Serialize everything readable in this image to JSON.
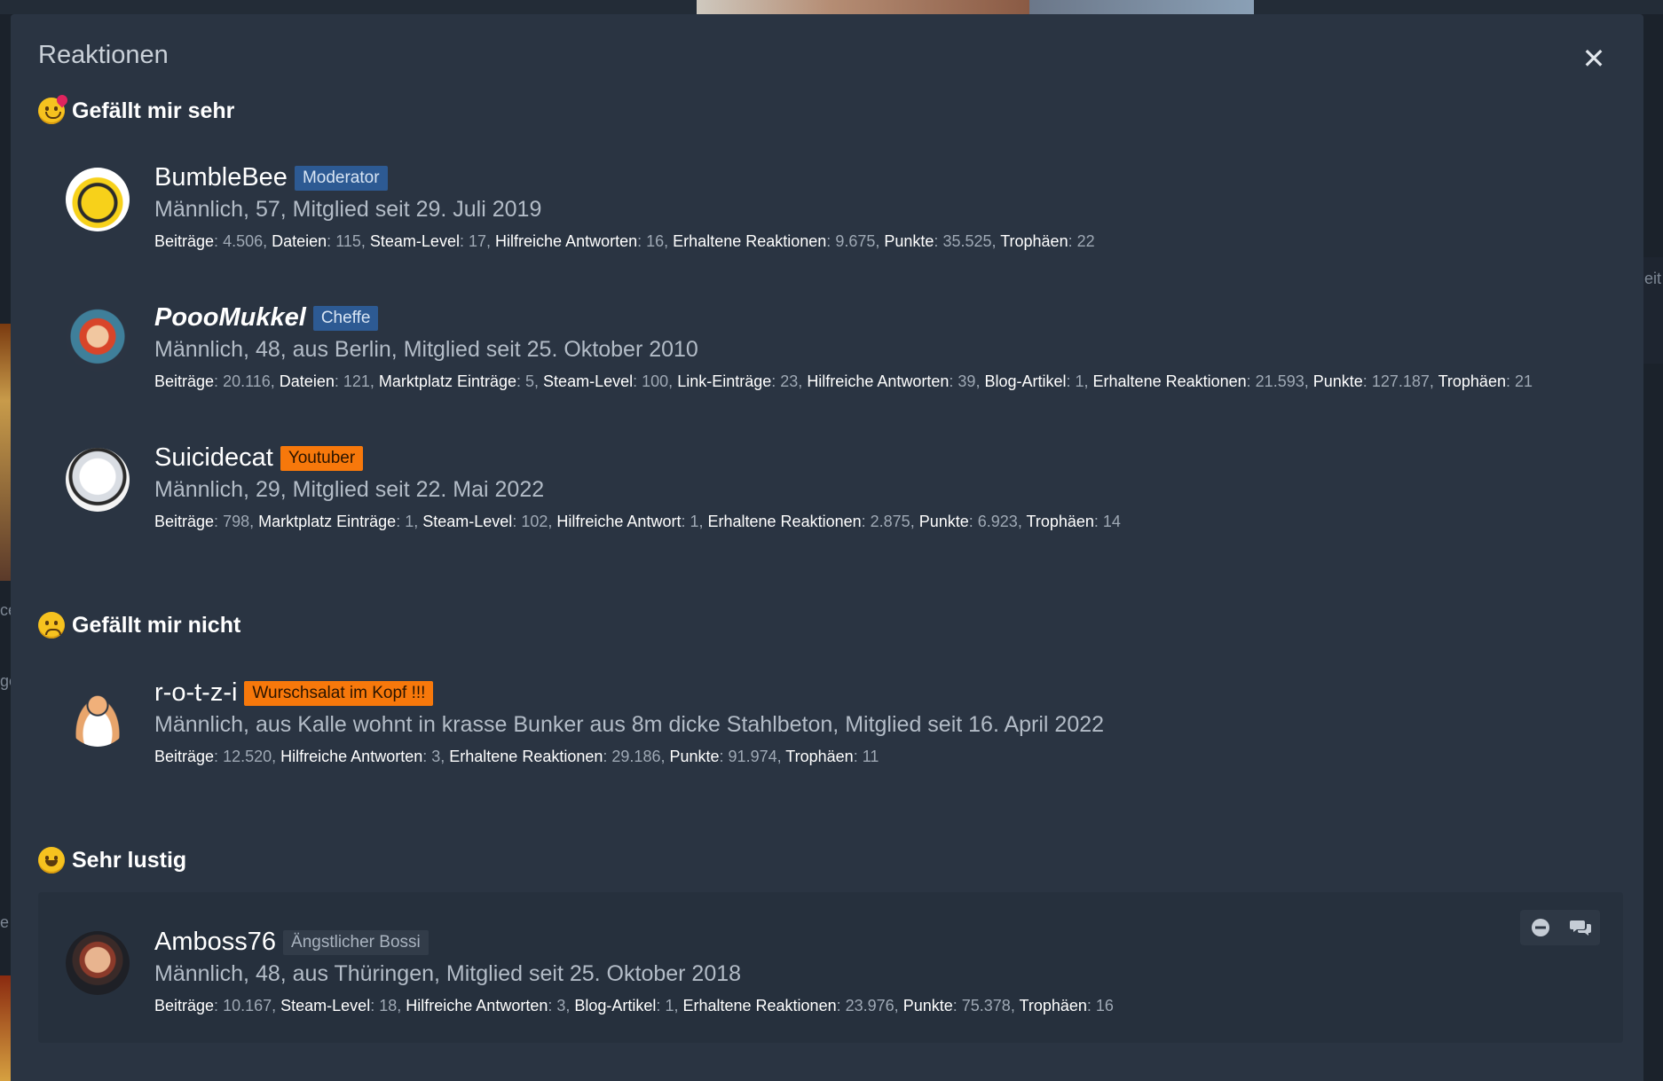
{
  "dialog": {
    "title": "Reaktionen",
    "close_glyph": "✕"
  },
  "colors": {
    "dialog_bg": "#2a3442",
    "badge_blue": "#2d5a93",
    "badge_orange": "#f7780b",
    "text_white": "#ffffff"
  },
  "background": {
    "edge_texts": [
      "eit",
      "ce",
      "ge",
      "e"
    ]
  },
  "sections": [
    {
      "label": "Gefällt mir sehr",
      "icon": "heart-eyes-emoji-icon",
      "users": [
        {
          "name": "BumbleBee",
          "badge": "Moderator",
          "info": "Männlich, 57, Mitglied seit 29. Juli 2019",
          "stats": [
            {
              "k": "Beiträge",
              "v": "4.506"
            },
            {
              "k": "Dateien",
              "v": "115"
            },
            {
              "k": "Steam-Level",
              "v": "17"
            },
            {
              "k": "Hilfreiche Antworten",
              "v": "16"
            },
            {
              "k": "Erhaltene Reaktionen",
              "v": "9.675"
            },
            {
              "k": "Punkte",
              "v": "35.525"
            },
            {
              "k": "Trophäen",
              "v": "22"
            }
          ]
        },
        {
          "name": "PoooMukkel",
          "badge": "Cheffe",
          "info": "Männlich, 48, aus Berlin, Mitglied seit 25. Oktober 2010",
          "stats": [
            {
              "k": "Beiträge",
              "v": "20.116"
            },
            {
              "k": "Dateien",
              "v": "121"
            },
            {
              "k": "Marktplatz Einträge",
              "v": "5"
            },
            {
              "k": "Steam-Level",
              "v": "100"
            },
            {
              "k": "Link-Einträge",
              "v": "23"
            },
            {
              "k": "Hilfreiche Antworten",
              "v": "39"
            },
            {
              "k": "Blog-Artikel",
              "v": "1"
            },
            {
              "k": "Erhaltene Reaktionen",
              "v": "21.593"
            },
            {
              "k": "Punkte",
              "v": "127.187"
            },
            {
              "k": "Trophäen",
              "v": "21"
            }
          ]
        },
        {
          "name": "Suicidecat",
          "badge": "Youtuber",
          "info": "Männlich, 29, Mitglied seit 22. Mai 2022",
          "stats": [
            {
              "k": "Beiträge",
              "v": "798"
            },
            {
              "k": "Marktplatz Einträge",
              "v": "1"
            },
            {
              "k": "Steam-Level",
              "v": "102"
            },
            {
              "k": "Hilfreiche Antwort",
              "v": "1"
            },
            {
              "k": "Erhaltene Reaktionen",
              "v": "2.875"
            },
            {
              "k": "Punkte",
              "v": "6.923"
            },
            {
              "k": "Trophäen",
              "v": "14"
            }
          ]
        }
      ]
    },
    {
      "label": "Gefällt mir nicht",
      "icon": "sad-face-emoji-icon",
      "users": [
        {
          "name": "r-o-t-z-i",
          "badge": "Wurschsalat im Kopf !!!",
          "info": "Männlich, aus Kalle wohnt in krasse Bunker aus 8m dicke Stahlbeton, Mitglied seit 16. April 2022",
          "stats": [
            {
              "k": "Beiträge",
              "v": "12.520"
            },
            {
              "k": "Hilfreiche Antworten",
              "v": "3"
            },
            {
              "k": "Erhaltene Reaktionen",
              "v": "29.186"
            },
            {
              "k": "Punkte",
              "v": "91.974"
            },
            {
              "k": "Trophäen",
              "v": "11"
            }
          ]
        }
      ]
    },
    {
      "label": "Sehr lustig",
      "icon": "laughing-emoji-icon",
      "users": [
        {
          "name": "Amboss76",
          "badge": "Ängstlicher Bossi",
          "info": "Männlich, 48, aus Thüringen, Mitglied seit 25. Oktober 2018",
          "stats": [
            {
              "k": "Beiträge",
              "v": "10.167"
            },
            {
              "k": "Steam-Level",
              "v": "18"
            },
            {
              "k": "Hilfreiche Antworten",
              "v": "3"
            },
            {
              "k": "Blog-Artikel",
              "v": "1"
            },
            {
              "k": "Erhaltene Reaktionen",
              "v": "23.976"
            },
            {
              "k": "Punkte",
              "v": "75.378"
            },
            {
              "k": "Trophäen",
              "v": "16"
            }
          ],
          "actions": [
            "ignore-icon",
            "conversation-icon"
          ]
        }
      ]
    }
  ]
}
